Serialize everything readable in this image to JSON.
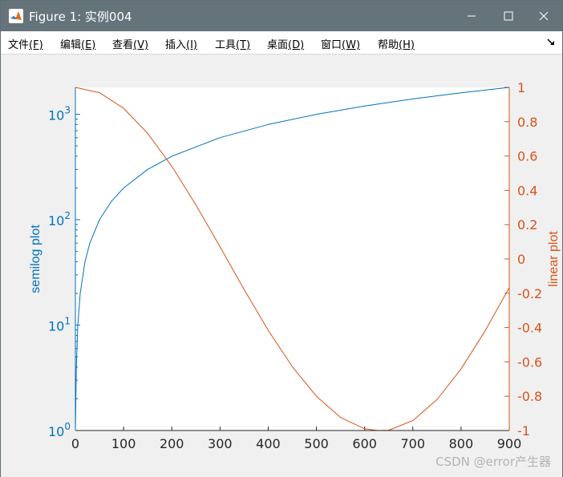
{
  "window": {
    "title": "Figure 1: 实例004",
    "controls": [
      "minimize-icon",
      "maximize-icon",
      "close-icon"
    ],
    "titlebar_color": "#65737a"
  },
  "menubar": {
    "items": [
      {
        "label": "文件",
        "accel": "(F)"
      },
      {
        "label": "编辑",
        "accel": "(E)"
      },
      {
        "label": "查看",
        "accel": "(V)"
      },
      {
        "label": "插入",
        "accel": "(I)"
      },
      {
        "label": "工具",
        "accel": "(T)"
      },
      {
        "label": "桌面",
        "accel": "(D)"
      },
      {
        "label": "窗口",
        "accel": "(W)"
      },
      {
        "label": "帮助",
        "accel": "(H)"
      }
    ],
    "dock_icon": "dock-arrow-icon"
  },
  "watermark": "CSDN @error产生器",
  "chart_data": {
    "type": "line",
    "x_axis": {
      "range": [
        0,
        900
      ],
      "ticks": [
        "0",
        "100",
        "200",
        "300",
        "400",
        "500",
        "600",
        "700",
        "800",
        "900"
      ]
    },
    "left_axis": {
      "label": "semilog plot",
      "scale": "log",
      "range": [
        1,
        1800
      ],
      "ticks": [
        {
          "base": "10",
          "exp": "0",
          "value": 1
        },
        {
          "base": "10",
          "exp": "1",
          "value": 10
        },
        {
          "base": "10",
          "exp": "2",
          "value": 100
        },
        {
          "base": "10",
          "exp": "3",
          "value": 1000
        }
      ],
      "color": "#0072bd"
    },
    "right_axis": {
      "label": "linear plot",
      "scale": "linear",
      "range": [
        -1,
        1
      ],
      "ticks": [
        "1",
        "0.8",
        "0.6",
        "0.4",
        "0.2",
        "0",
        "-0.2",
        "-0.4",
        "-0.6",
        "-0.8",
        "-1"
      ],
      "color": "#d95319"
    },
    "series": [
      {
        "axis": "left",
        "color": "#0072bd",
        "x": [
          0,
          2,
          5,
          10,
          20,
          30,
          50,
          75,
          100,
          150,
          200,
          300,
          400,
          500,
          600,
          700,
          800,
          900
        ],
        "y": [
          1,
          4,
          10,
          20,
          40,
          60,
          100,
          150,
          200,
          300,
          400,
          600,
          800,
          1000,
          1200,
          1400,
          1600,
          1800
        ]
      },
      {
        "axis": "right",
        "color": "#d95319",
        "x": [
          0,
          50,
          100,
          150,
          200,
          250,
          300,
          350,
          400,
          450,
          500,
          550,
          600,
          628,
          650,
          700,
          750,
          800,
          850,
          900
        ],
        "y": [
          1,
          0.969,
          0.878,
          0.732,
          0.54,
          0.315,
          0.071,
          -0.178,
          -0.416,
          -0.628,
          -0.801,
          -0.924,
          -0.99,
          -1,
          -0.998,
          -0.942,
          -0.82,
          -0.641,
          -0.419,
          -0.167
        ]
      }
    ]
  }
}
